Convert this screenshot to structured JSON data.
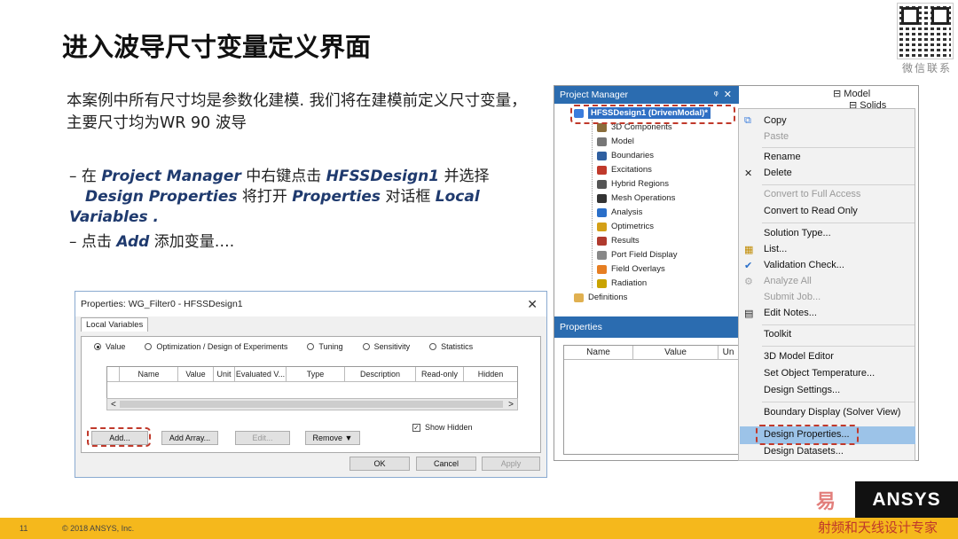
{
  "slide": {
    "title": "进入波导尺寸变量定义界面",
    "qr_label": "微信联系",
    "intro": "本案例中所有尺寸均是参数化建模. 我们将在建模前定义尺寸变量，主要尺寸均为WR 90 波导",
    "bullet1": {
      "t1": "– 在 ",
      "e1": "Project Manager",
      "t2": " 中右键点击 ",
      "e2": "HFSSDesign1",
      "t3": " 并选择 ",
      "e3": "Design Properties",
      "t4": "  将打开 ",
      "e4": "Properties",
      "t5": " 对话框 ",
      "e5": "Local Variables",
      "t6": " ."
    },
    "bullet2": {
      "t1": "– 点击 ",
      "e1": "Add",
      "t2": " 添加变量…."
    },
    "page_number": "11",
    "copyright": "© 2018 ANSYS, Inc.",
    "logo": "ANSYS",
    "watermark_top": "易",
    "watermark_bottom": "射频和天线设计专家"
  },
  "dialog": {
    "title": "Properties: WG_Filter0 - HFSSDesign1",
    "close": "✕",
    "tab": "Local Variables",
    "radios": [
      "Value",
      "Optimization / Design of Experiments",
      "Tuning",
      "Sensitivity",
      "Statistics"
    ],
    "columns": [
      "Name",
      "Value",
      "Unit",
      "Evaluated V...",
      "Type",
      "Description",
      "Read-only",
      "Hidden"
    ],
    "scroll_left": "<",
    "scroll_right": ">",
    "show_hidden": "Show Hidden",
    "show_hidden_checked": "✓",
    "buttons": {
      "add": "Add...",
      "add_array": "Add Array...",
      "edit": "Edit...",
      "remove": "Remove",
      "remove_arrow": "▼",
      "ok": "OK",
      "cancel": "Cancel",
      "apply": "Apply"
    }
  },
  "project_manager": {
    "title": "Project Manager",
    "pin": "ᵠ",
    "close": "✕",
    "design": "HFSSDesign1 (DrivenModal)*",
    "items": [
      "3D Components",
      "Model",
      "Boundaries",
      "Excitations",
      "Hybrid Regions",
      "Mesh Operations",
      "Analysis",
      "Optimetrics",
      "Results",
      "Port Field Display",
      "Field Overlays",
      "Radiation"
    ],
    "definitions": "Definitions",
    "right_tree": [
      "Model",
      "Solids"
    ],
    "properties_title": "Properties",
    "properties_cols": [
      "Name",
      "Value",
      "Un"
    ]
  },
  "context_menu": {
    "items": [
      {
        "label": "Copy",
        "enabled": true
      },
      {
        "label": "Paste",
        "enabled": false
      },
      {
        "label": "Rename",
        "enabled": true
      },
      {
        "label": "Delete",
        "enabled": true
      },
      {
        "label": "Convert to Full Access",
        "enabled": false
      },
      {
        "label": "Convert to Read Only",
        "enabled": true
      },
      {
        "label": "Solution Type...",
        "enabled": true
      },
      {
        "label": "List...",
        "enabled": true
      },
      {
        "label": "Validation Check...",
        "enabled": true
      },
      {
        "label": "Analyze All",
        "enabled": false
      },
      {
        "label": "Submit Job...",
        "enabled": false
      },
      {
        "label": "Edit Notes...",
        "enabled": true
      },
      {
        "label": "Toolkit",
        "enabled": true
      },
      {
        "label": "3D Model Editor",
        "enabled": true
      },
      {
        "label": "Set Object Temperature...",
        "enabled": true
      },
      {
        "label": "Design Settings...",
        "enabled": true
      },
      {
        "label": "Boundary Display (Solver View)",
        "enabled": true
      },
      {
        "label": "Design Properties...",
        "enabled": true,
        "highlighted": true
      },
      {
        "label": "Design Datasets...",
        "enabled": true
      }
    ],
    "icons": {
      "copy": "⧉",
      "delete": "✕",
      "list": "▦",
      "validation": "✔",
      "analyze": "⚙",
      "notes": "▤"
    }
  }
}
